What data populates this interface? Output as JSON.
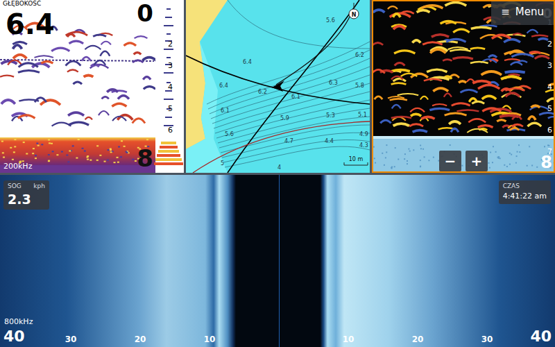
{
  "sonar": {
    "title": "GŁĘBOKOŚĆ",
    "depth": "6.4",
    "range_top": "0",
    "range_bottom": "8",
    "ticks": [
      "2",
      "3",
      "4",
      "5",
      "6"
    ],
    "frequency": "200kHz"
  },
  "chart": {
    "north": "N",
    "depths": [
      "6.4",
      "6.4",
      "6.2",
      "6.1",
      "6.1",
      "6.3",
      "5.8",
      "6.2",
      "5.6",
      "5.9",
      "5.3",
      "5.1",
      "4.9",
      "4.7",
      "4.4",
      "4.3",
      "5.6",
      "5",
      "4"
    ],
    "scale": "10 m"
  },
  "downscan": {
    "selected": true,
    "menu_icon": "≡",
    "menu": "Menu",
    "range_top": "0",
    "range_bottom": "8",
    "ticks": [
      "1",
      "2",
      "3",
      "4",
      "5",
      "6",
      "7"
    ],
    "zoom_out": "−",
    "zoom_in": "+"
  },
  "sidescan": {
    "speed": {
      "label": "SOG",
      "unit": "kph",
      "value": "2.3"
    },
    "time": {
      "label": "CZAS",
      "value": "4:41:22 am"
    },
    "frequency": "800kHz",
    "range_left": "40",
    "range_right": "40",
    "ticks_left": [
      "30",
      "20",
      "10"
    ],
    "ticks_right": [
      "10",
      "20",
      "30"
    ]
  }
}
